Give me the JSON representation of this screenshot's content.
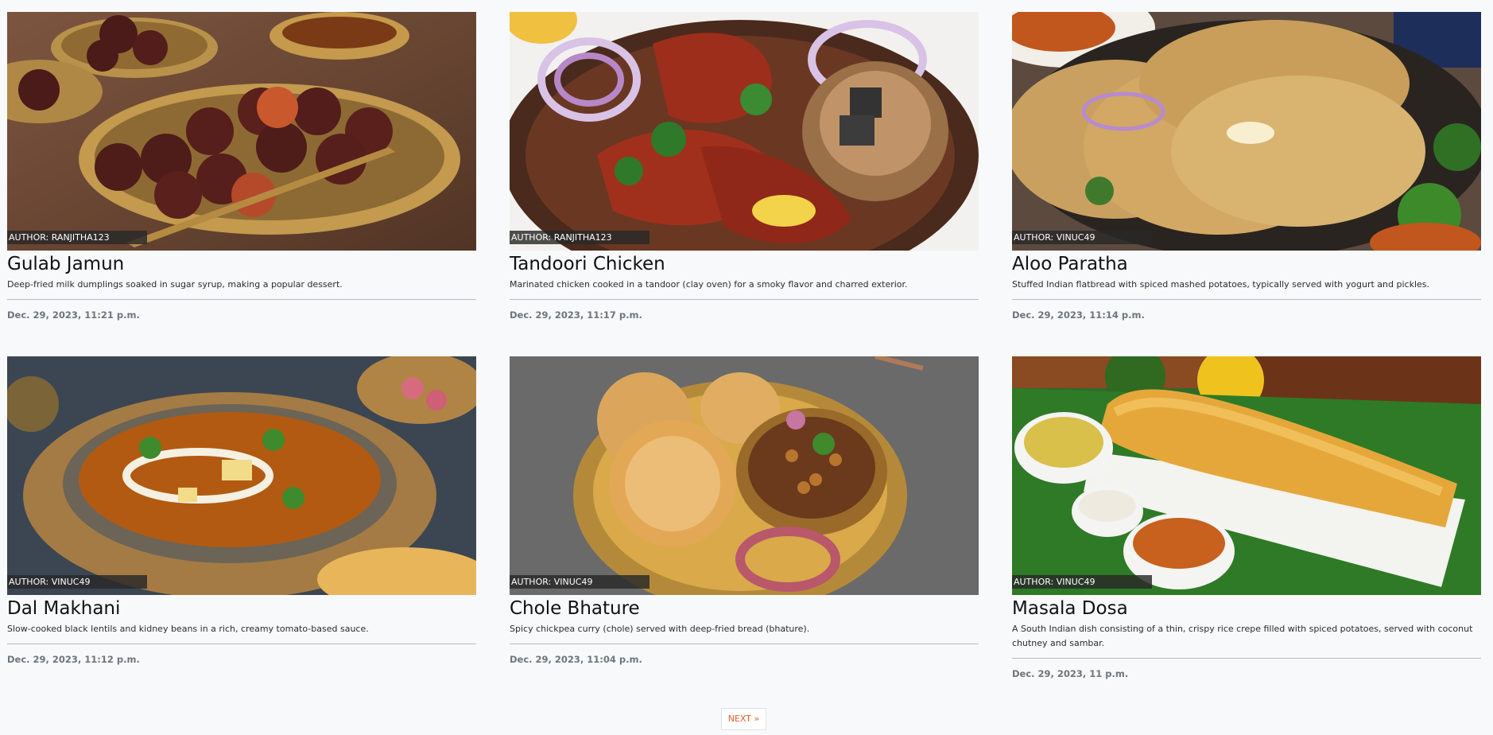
{
  "recipes": [
    {
      "author": "AUTHOR: RANJITHA123",
      "title": "Gulab Jamun",
      "description": "Deep-fried milk dumplings soaked in sugar syrup, making a popular dessert.",
      "date": "Dec. 29, 2023, 11:21 p.m.",
      "image": "gulab-jamun-photo"
    },
    {
      "author": "AUTHOR: RANJITHA123",
      "title": "Tandoori Chicken",
      "description": "Marinated chicken cooked in a tandoor (clay oven) for a smoky flavor and charred exterior.",
      "date": "Dec. 29, 2023, 11:17 p.m.",
      "image": "tandoori-chicken-photo"
    },
    {
      "author": "AUTHOR: VINUC49",
      "title": "Aloo Paratha",
      "description": "Stuffed Indian flatbread with spiced mashed potatoes, typically served with yogurt and pickles.",
      "date": "Dec. 29, 2023, 11:14 p.m.",
      "image": "aloo-paratha-photo"
    },
    {
      "author": "AUTHOR: VINUC49",
      "title": "Dal Makhani",
      "description": "Slow-cooked black lentils and kidney beans in a rich, creamy tomato-based sauce.",
      "date": "Dec. 29, 2023, 11:12 p.m.",
      "image": "dal-makhani-photo"
    },
    {
      "author": "AUTHOR: VINUC49",
      "title": "Chole Bhature",
      "description": "Spicy chickpea curry (chole) served with deep-fried bread (bhature).",
      "date": "Dec. 29, 2023, 11:04 p.m.",
      "image": "chole-bhature-photo"
    },
    {
      "author": "AUTHOR: VINUC49",
      "title": "Masala Dosa",
      "description": "A South Indian dish consisting of a thin, crispy rice crepe filled with spiced potatoes, served with coconut chutney and sambar.",
      "date": "Dec. 29, 2023, 11 p.m.",
      "image": "masala-dosa-photo"
    }
  ],
  "pagination": {
    "next_label": "NEXT »"
  },
  "colors": {
    "background": "#f8f9fa",
    "accent": "#e05d2c",
    "muted": "#6c757d"
  }
}
